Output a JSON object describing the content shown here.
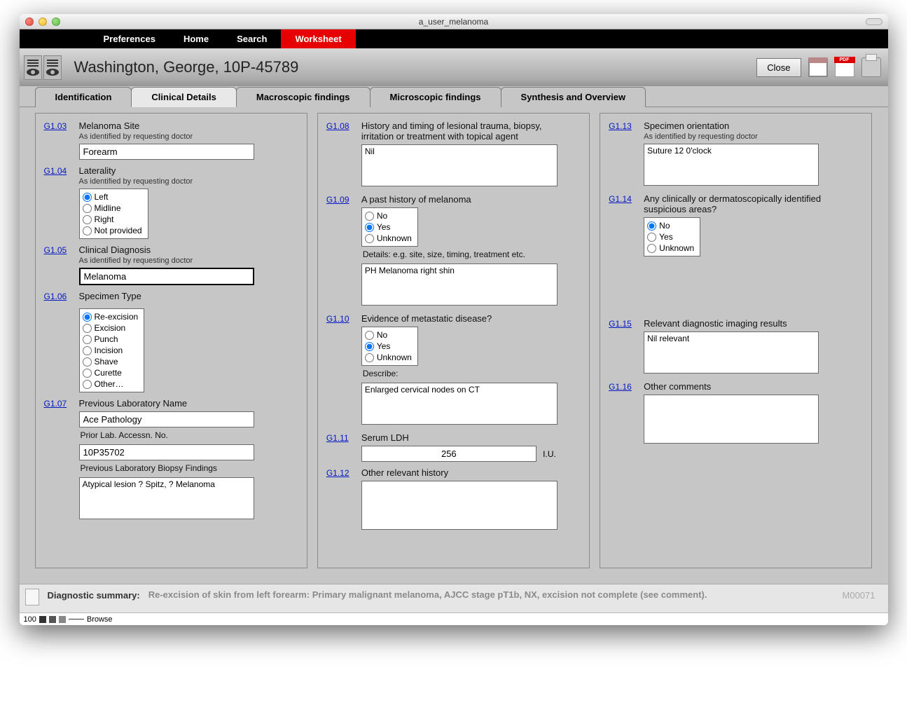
{
  "window": {
    "title": "a_user_melanoma"
  },
  "menubar": {
    "items": [
      "Preferences",
      "Home",
      "Search",
      "Worksheet"
    ],
    "active": "Worksheet"
  },
  "header": {
    "patient": "Washington, George, 10P-45789",
    "close_label": "Close"
  },
  "tabs": {
    "items": [
      "Identification",
      "Clinical Details",
      "Macroscopic findings",
      "Microscopic findings",
      "Synthesis and Overview"
    ],
    "active": "Clinical Details"
  },
  "col1": {
    "g103": {
      "code": "G1.03",
      "label": "Melanoma Site",
      "sublabel": "As identified by requesting doctor",
      "value": "Forearm"
    },
    "g104": {
      "code": "G1.04",
      "label": "Laterality",
      "sublabel": "As identified by requesting doctor",
      "options": [
        "Left",
        "Midline",
        "Right",
        "Not provided"
      ],
      "selected": "Left"
    },
    "g105": {
      "code": "G1.05",
      "label": "Clinical Diagnosis",
      "sublabel": "As identified by requesting doctor",
      "value": "Melanoma"
    },
    "g106": {
      "code": "G1.06",
      "label": "Specimen Type",
      "options": [
        "Re-excision",
        "Excision",
        "Punch",
        "Incision",
        "Shave",
        "Curette",
        "Other…"
      ],
      "selected": "Re-excision"
    },
    "g107": {
      "code": "G1.07",
      "label": "Previous Laboratory Name",
      "value": "Ace Pathology",
      "accession_label": "Prior Lab. Accessn. No.",
      "accession_value": "10P35702",
      "findings_label": "Previous Laboratory Biopsy Findings",
      "findings_value": "Atypical lesion ? Spitz, ? Melanoma"
    }
  },
  "col2": {
    "g108": {
      "code": "G1.08",
      "label": "History and timing of lesional trauma, biopsy, irritation or treatment with topical agent",
      "value": "Nil"
    },
    "g109": {
      "code": "G1.09",
      "label": "A past history of melanoma",
      "options": [
        "No",
        "Yes",
        "Unknown"
      ],
      "selected": "Yes",
      "details_label": "Details: e.g. site, size, timing, treatment etc.",
      "details_value": "PH Melanoma right shin"
    },
    "g110": {
      "code": "G1.10",
      "label": "Evidence of metastatic disease?",
      "options": [
        "No",
        "Yes",
        "Unknown"
      ],
      "selected": "Yes",
      "describe_label": "Describe:",
      "describe_value": "Enlarged cervical nodes on CT"
    },
    "g111": {
      "code": "G1.11",
      "label": "Serum LDH",
      "value": "256",
      "unit": "I.U."
    },
    "g112": {
      "code": "G1.12",
      "label": "Other relevant history",
      "value": ""
    }
  },
  "col3": {
    "g113": {
      "code": "G1.13",
      "label": "Specimen orientation",
      "sublabel": "As identified by requesting doctor",
      "value": "Suture 12 0'clock"
    },
    "g114": {
      "code": "G1.14",
      "label": "Any clinically or dermatoscopically identified suspicious areas?",
      "options": [
        "No",
        "Yes",
        "Unknown"
      ],
      "selected": "No"
    },
    "g115": {
      "code": "G1.15",
      "label": "Relevant diagnostic imaging results",
      "value": "Nil relevant"
    },
    "g116": {
      "code": "G1.16",
      "label": "Other comments",
      "value": ""
    }
  },
  "footer": {
    "ds_label": "Diagnostic summary:",
    "ds_text": "Re-excision of skin from left forearm: Primary malignant melanoma, AJCC stage pT1b, NX, excision not complete (see comment).",
    "case_id": "M00071"
  },
  "statusbar": {
    "zoom": "100",
    "mode": "Browse"
  }
}
